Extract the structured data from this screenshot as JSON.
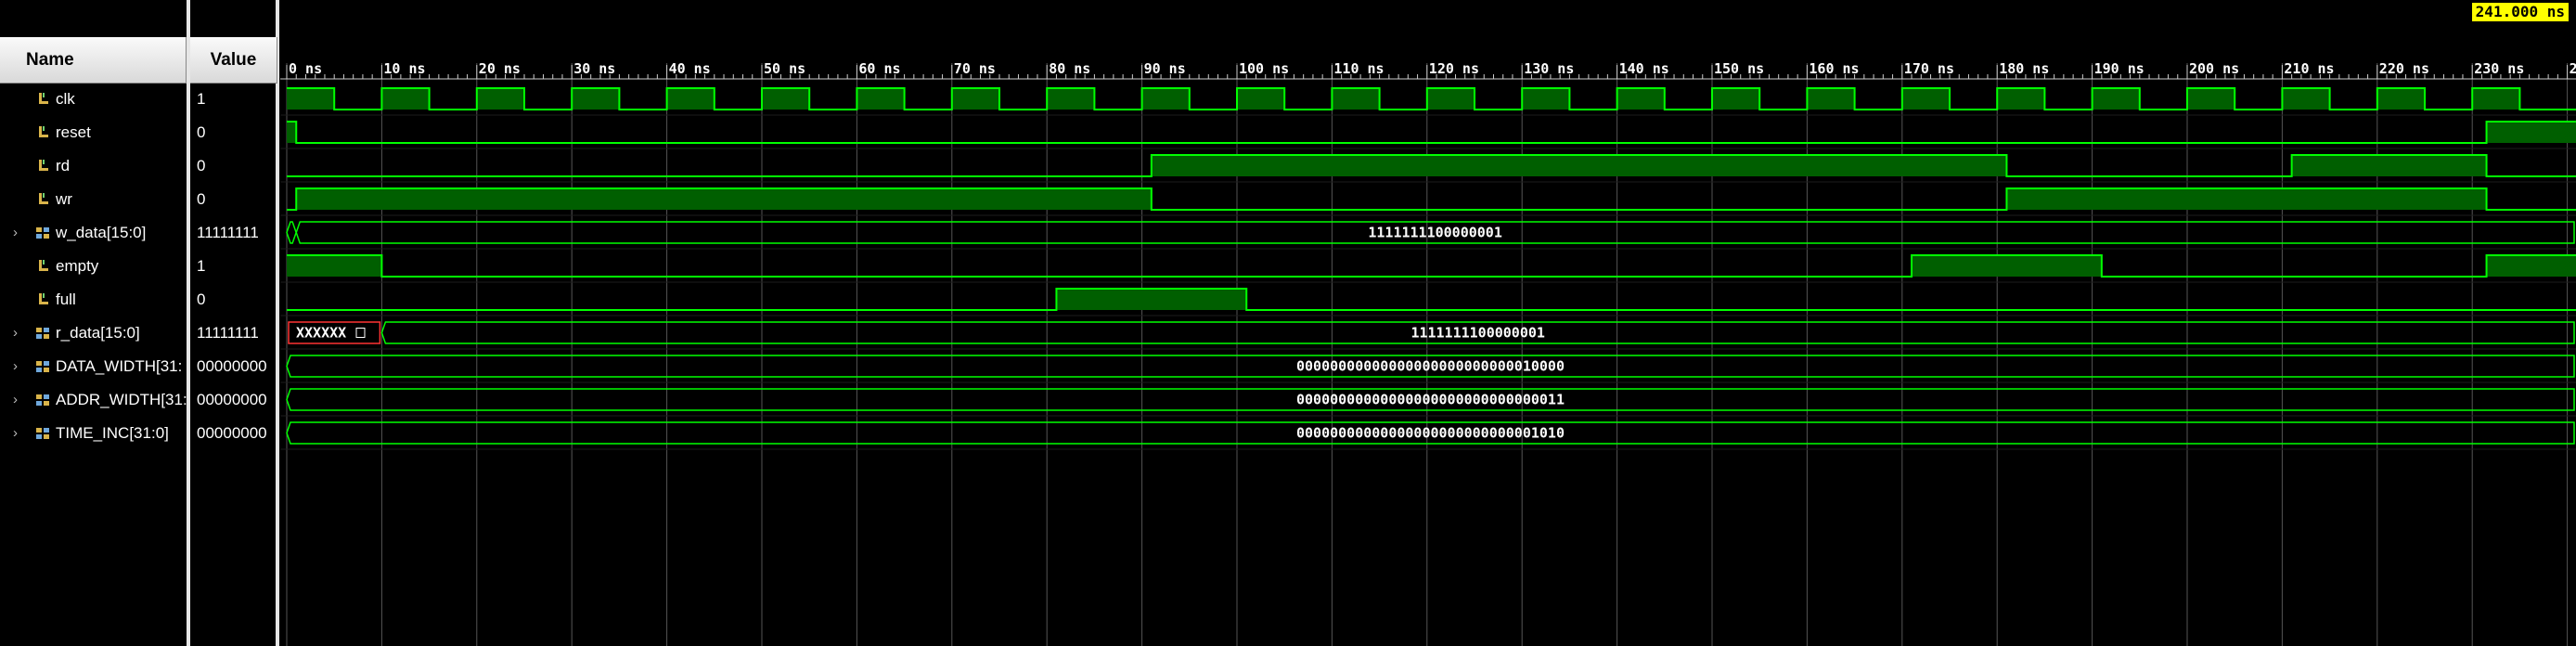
{
  "header": {
    "name": "Name",
    "value": "Value"
  },
  "cursor_time": "241.000 ns",
  "colors": {
    "wave": "#00ff00",
    "wave_fill": "#005f00",
    "grid": "#555555",
    "bus_x_box": "#ff3333",
    "cursor_bg": "#ffff00"
  },
  "timeline": {
    "ticks": [
      "0 ns",
      "10 ns",
      "20 ns",
      "30 ns",
      "40 ns",
      "50 ns",
      "60 ns",
      "70 ns",
      "80 ns",
      "90 ns",
      "100 ns",
      "110 ns",
      "120 ns",
      "130 ns",
      "140 ns",
      "150 ns",
      "160 ns",
      "170 ns",
      "180 ns",
      "190 ns",
      "200 ns",
      "210 ns",
      "220 ns",
      "230 ns",
      "2"
    ]
  },
  "signals": [
    {
      "name": "clk",
      "value": "1",
      "kind": "bit",
      "expandable": false,
      "icon": "bit-signal-icon"
    },
    {
      "name": "reset",
      "value": "0",
      "kind": "bit",
      "expandable": false,
      "icon": "bit-signal-icon"
    },
    {
      "name": "rd",
      "value": "0",
      "kind": "bit",
      "expandable": false,
      "icon": "bit-signal-icon"
    },
    {
      "name": "wr",
      "value": "0",
      "kind": "bit",
      "expandable": false,
      "icon": "bit-signal-icon"
    },
    {
      "name": "w_data[15:0]",
      "value": "11111111",
      "kind": "bus",
      "expandable": true,
      "icon": "bus-signal-icon",
      "bus_text": "1111111100000001"
    },
    {
      "name": "empty",
      "value": "1",
      "kind": "bit",
      "expandable": false,
      "icon": "bit-signal-icon"
    },
    {
      "name": "full",
      "value": "0",
      "kind": "bit",
      "expandable": false,
      "icon": "bit-signal-icon"
    },
    {
      "name": "r_data[15:0]",
      "value": "11111111",
      "kind": "bus",
      "expandable": true,
      "icon": "bus-signal-icon",
      "bus_text": "1111111100000001",
      "initial_text": "XXXXXX"
    },
    {
      "name": "DATA_WIDTH[31:",
      "value": "00000000",
      "kind": "bus",
      "expandable": true,
      "icon": "bus-signal-icon",
      "bus_text": "00000000000000000000000000010000"
    },
    {
      "name": "ADDR_WIDTH[31:",
      "value": "00000000",
      "kind": "bus",
      "expandable": true,
      "icon": "bus-signal-icon",
      "bus_text": "00000000000000000000000000000011"
    },
    {
      "name": "TIME_INC[31:0]",
      "value": "00000000",
      "kind": "bus",
      "expandable": true,
      "icon": "bus-signal-icon",
      "bus_text": "00000000000000000000000000001010"
    }
  ]
}
